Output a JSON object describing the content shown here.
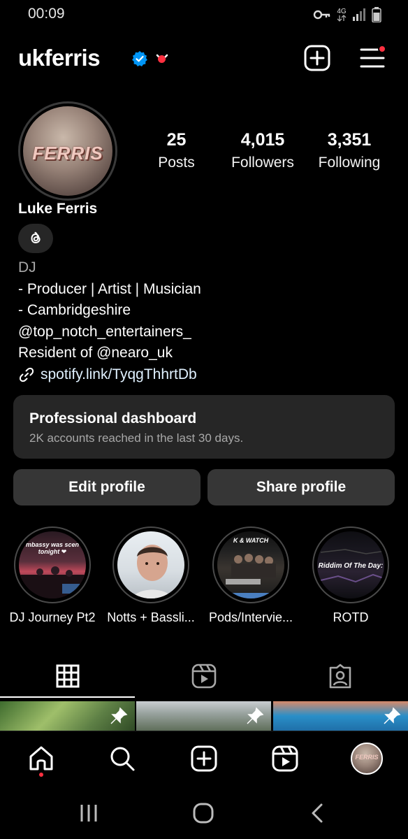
{
  "status_bar": {
    "time": "00:09",
    "network_label": "4G",
    "icons": [
      "key-icon",
      "network-4g-icon",
      "signal-icon",
      "battery-icon"
    ]
  },
  "header": {
    "username": "ukferris",
    "verified": true,
    "icons": [
      "verified-badge-icon",
      "chevron-down-icon",
      "new-post-icon",
      "menu-icon"
    ],
    "notification_color": "#ff3040"
  },
  "profile": {
    "avatar_text": "FERRIS",
    "stats": {
      "posts_value": "25",
      "posts_label": "Posts",
      "followers_value": "4,015",
      "followers_label": "Followers",
      "following_value": "3,351",
      "following_label": "Following"
    },
    "full_name": "Luke Ferris",
    "threads_icon": "threads-icon",
    "bio": {
      "category": "DJ",
      "line1": "- Producer | Artist | Musician",
      "line2": "- Cambridgeshire",
      "line3": "@top_notch_entertainers_",
      "line4": "Resident of @nearo_uk",
      "link": "spotify.link/TyqgThhrtDb"
    }
  },
  "dashboard": {
    "title": "Professional dashboard",
    "subtitle": "2K accounts reached in the last 30 days."
  },
  "actions": {
    "edit_label": "Edit profile",
    "share_label": "Share profile"
  },
  "highlights": [
    {
      "label": "DJ Journey Pt2",
      "caption": "mbassy was scen tonight ❤"
    },
    {
      "label": "Notts + Bassli...",
      "caption": ""
    },
    {
      "label": "Pods/Intervie...",
      "caption": "K & WATCH"
    },
    {
      "label": "ROTD",
      "caption": "Riddim Of The Day:"
    }
  ],
  "tabs": [
    "grid-icon",
    "reels-icon",
    "tagged-icon"
  ],
  "bottom_nav": [
    "home-icon",
    "search-icon",
    "create-icon",
    "reels-icon",
    "profile-avatar"
  ],
  "system_nav": [
    "recents-icon",
    "home-circle-icon",
    "back-icon"
  ],
  "colors": {
    "background": "#000000",
    "card": "#262626",
    "button": "#363636",
    "verified_blue": "#0095f6",
    "accent_red": "#ff3040",
    "secondary_text": "#a8a8a8"
  }
}
